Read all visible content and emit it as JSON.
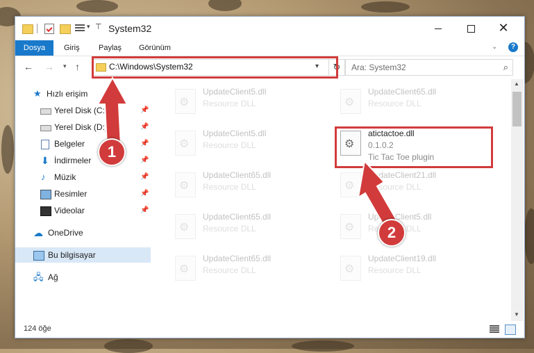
{
  "window": {
    "title": "System32",
    "controls": {
      "minimize": "",
      "maximize": "",
      "close": "✕"
    }
  },
  "ribbon": {
    "tabs": [
      "Dosya",
      "Giriş",
      "Paylaş",
      "Görünüm"
    ],
    "active_tab": "Dosya",
    "help": "?"
  },
  "address": {
    "path": "C:\\Windows\\System32",
    "search_placeholder": "Ara: System32"
  },
  "sidebar": {
    "items": [
      {
        "label": "Hızlı erişim",
        "icon": "star-icon",
        "pinned": false
      },
      {
        "label": "Yerel Disk (C:)",
        "icon": "drive-icon",
        "pinned": true
      },
      {
        "label": "Yerel Disk (D:)",
        "icon": "drive-icon",
        "pinned": true
      },
      {
        "label": "Belgeler",
        "icon": "documents-icon",
        "pinned": true
      },
      {
        "label": "İndirmeler",
        "icon": "download-icon",
        "pinned": true
      },
      {
        "label": "Müzik",
        "icon": "music-icon",
        "pinned": true
      },
      {
        "label": "Resimler",
        "icon": "pictures-icon",
        "pinned": true
      },
      {
        "label": "Videolar",
        "icon": "videos-icon",
        "pinned": true
      },
      {
        "label": "OneDrive",
        "icon": "cloud-icon",
        "pinned": false
      },
      {
        "label": "Bu bilgisayar",
        "icon": "computer-icon",
        "pinned": false,
        "selected": true
      },
      {
        "label": "Ağ",
        "icon": "network-icon",
        "pinned": false
      }
    ]
  },
  "files": [
    {
      "name": "UpdateClient5.dll",
      "sub": "Resource DLL",
      "faded": true
    },
    {
      "name": "UpdateClient65.dll",
      "sub": "Resource DLL",
      "faded": true
    },
    {
      "name": "UpdateClient5.dll",
      "sub": "Resource DLL",
      "faded": true
    },
    {
      "name": "atictactoe.dll",
      "sub": "0.1.0.2",
      "desc": "Tic Tac Toe plugin",
      "faded": false
    },
    {
      "name": "UpdateClient65.dll",
      "sub": "Resource DLL",
      "faded": true
    },
    {
      "name": "UpdateClient21.dll",
      "sub": "Resource DLL",
      "faded": true
    },
    {
      "name": "UpdateClient65.dll",
      "sub": "Resource DLL",
      "faded": true
    },
    {
      "name": "UpdateClient5.dll",
      "sub": "Resource DLL",
      "faded": true
    },
    {
      "name": "UpdateClient65.dll",
      "sub": "Resource DLL",
      "faded": true
    },
    {
      "name": "UpdateClient19.dll",
      "sub": "Resource DLL",
      "faded": true
    }
  ],
  "status": {
    "count": "124 öğe"
  },
  "annotations": {
    "step1": "1",
    "step2": "2",
    "color": "#d23b3b"
  }
}
